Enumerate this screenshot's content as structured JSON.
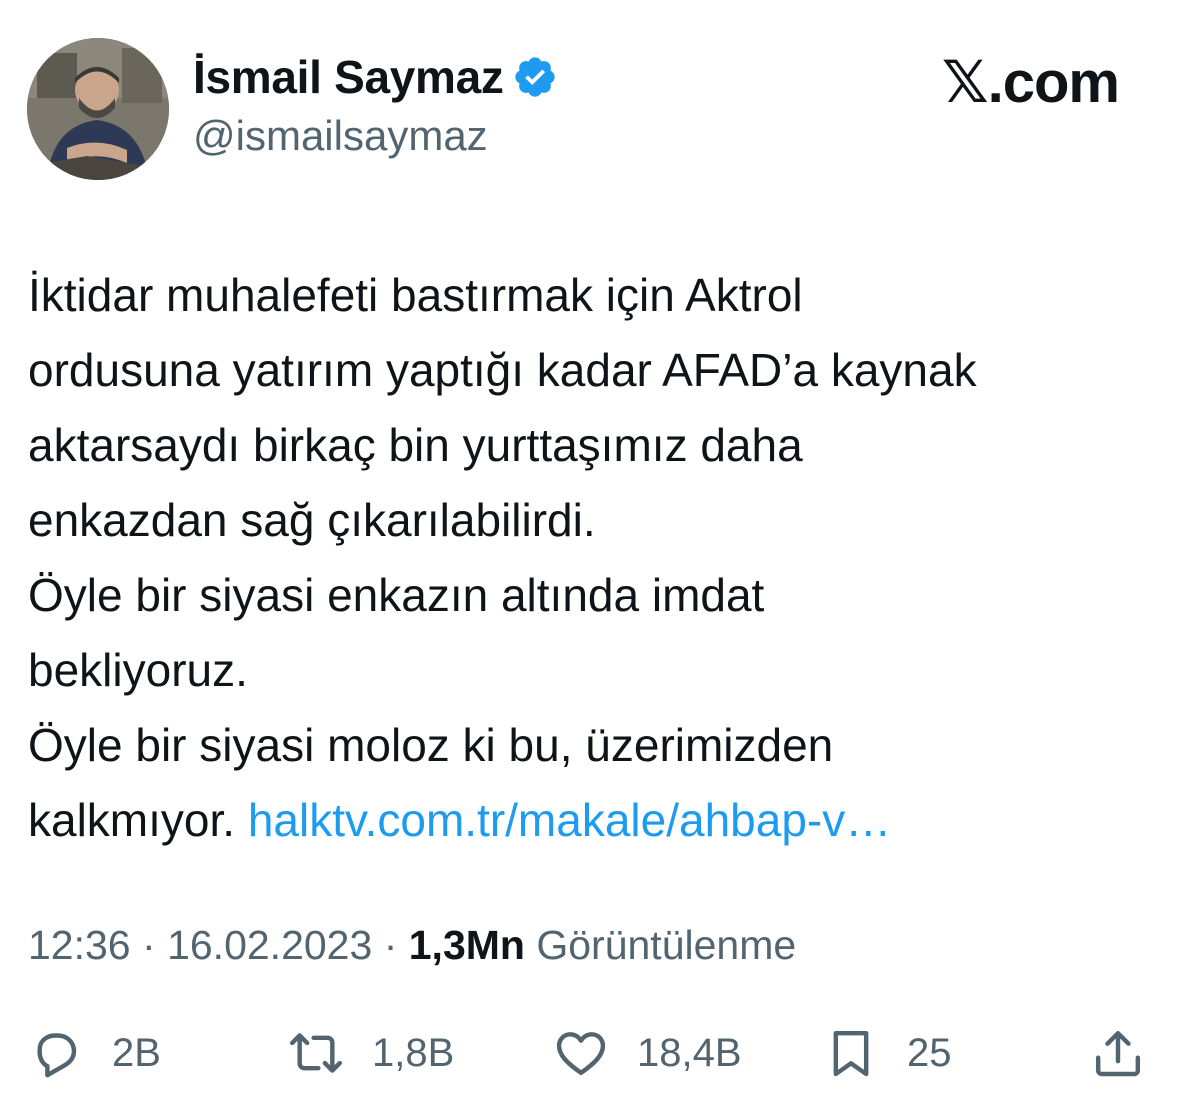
{
  "brand": {
    "logo_text": "𝕏.com"
  },
  "author": {
    "name": "İsmail Saymaz",
    "handle": "@ismailsaymaz",
    "verified_color": "#1d9bf0"
  },
  "tweet": {
    "lines": [
      "İktidar muhalefeti bastırmak için Aktrol",
      "ordusuna yatırım yaptığı kadar AFAD’a kaynak",
      "aktarsaydı birkaç bin yurttaşımız daha",
      "enkazdan sağ çıkarılabilirdi.",
      "Öyle bir siyasi enkazın altında imdat",
      "bekliyoruz.",
      "Öyle bir siyasi moloz ki bu, üzerimizden"
    ],
    "last_line_text": "kalkmıyor.",
    "link_text": "halktv.com.tr/makale/ahbap-v…",
    "link_color": "#1d9bf0"
  },
  "meta": {
    "time": "12:36",
    "sep1": "·",
    "date": "16.02.2023",
    "sep2": "·",
    "views_count": "1,3Mn",
    "views_label": "Görüntülenme"
  },
  "actions": {
    "replies": {
      "icon": "reply-icon",
      "count": "2B"
    },
    "reposts": {
      "icon": "repost-icon",
      "count": "1,8B"
    },
    "likes": {
      "icon": "heart-icon",
      "count": "18,4B"
    },
    "bookmarks": {
      "icon": "bookmark-icon",
      "count": "25"
    },
    "share": {
      "icon": "share-icon"
    }
  },
  "colors": {
    "text": "#0f1419",
    "secondary": "#536471",
    "accent": "#1d9bf0"
  }
}
